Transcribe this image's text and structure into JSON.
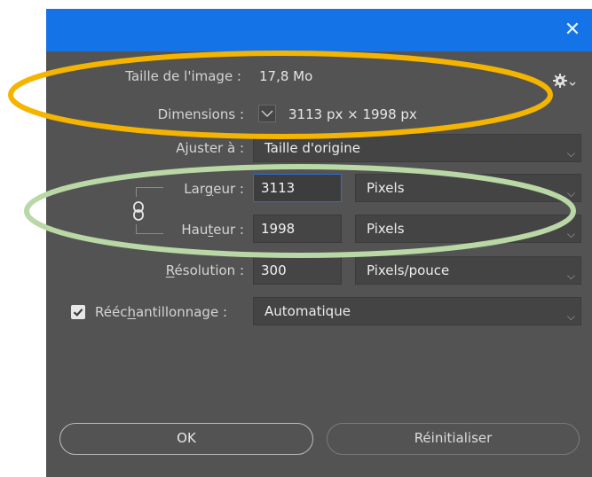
{
  "dialog": {
    "close_glyph": "✕",
    "image_size_label": "Taille de l'image :",
    "image_size_value": "17,8 Mo",
    "dimensions_label": "Dimensions :",
    "dimensions_value": "3113 px  ×  1998 px",
    "fit_to_label": "Ajuster à :",
    "fit_to_value": "Taille d'origine",
    "width_label_pre": "Lar",
    "width_label_u": "g",
    "width_label_post": "eur :",
    "width_value": "3113",
    "width_unit": "Pixels",
    "height_label_pre": "Hau",
    "height_label_u": "t",
    "height_label_post": "eur :",
    "height_value": "1998",
    "height_unit": "Pixels",
    "resolution_label_u": "R",
    "resolution_label_post": "ésolution :",
    "resolution_value": "300",
    "resolution_unit": "Pixels/pouce",
    "resample_label_pre": "Rééc",
    "resample_label_u": "h",
    "resample_label_post": "antillonnage :",
    "resample_checked": true,
    "resample_value": "Automatique",
    "ok_label": "OK",
    "reset_label": "Réinitialiser"
  },
  "icons": {
    "close": "close-icon",
    "gear": "gear-icon",
    "chain": "link-chain-icon",
    "chevron": "chevron-down-icon",
    "check": "checkmark-icon"
  },
  "colors": {
    "titlebar": "#1473e6",
    "panel": "#535353",
    "focus_border": "#2a6fd6",
    "annotation_orange": "#f5b400",
    "annotation_green": "#b9d8a6"
  }
}
